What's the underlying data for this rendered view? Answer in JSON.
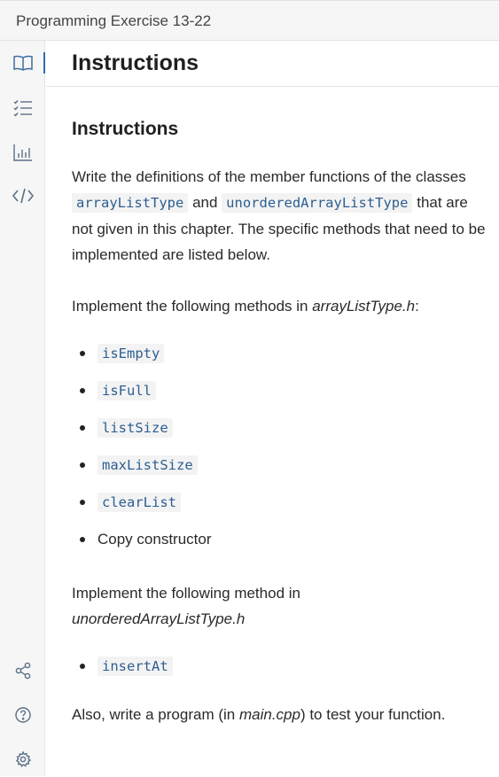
{
  "window": {
    "title": "Programming Exercise 13-22"
  },
  "sidebar": {
    "items": [
      {
        "name": "book-icon",
        "label": "Instructions"
      },
      {
        "name": "checklist-icon",
        "label": "Tasks"
      },
      {
        "name": "chart-icon",
        "label": "Results"
      },
      {
        "name": "code-icon",
        "label": "Code"
      },
      {
        "name": "share-icon",
        "label": "Share"
      },
      {
        "name": "help-icon",
        "label": "Help"
      },
      {
        "name": "gear-icon",
        "label": "Settings"
      }
    ],
    "accent_color": "#2b6cb0"
  },
  "header": {
    "title": "Instructions"
  },
  "content": {
    "heading": "Instructions",
    "intro": {
      "t1": "Write the definitions of the member functions of the classes",
      "code1": "arrayListType",
      "t2": "and",
      "code2": "unorderedArrayListType",
      "t3": "that are not given in this chapter. The specific methods that need to be implemented are listed below."
    },
    "section1": {
      "prefix": "Implement the following methods in",
      "file": "arrayListType.h",
      "suffix": ":"
    },
    "methods1": [
      {
        "label": "isEmpty",
        "is_code": true
      },
      {
        "label": "isFull",
        "is_code": true
      },
      {
        "label": "listSize",
        "is_code": true
      },
      {
        "label": "maxListSize",
        "is_code": true
      },
      {
        "label": "clearList",
        "is_code": true
      },
      {
        "label": "Copy constructor",
        "is_code": false
      }
    ],
    "section2": {
      "prefix": "Implement the following method in",
      "file": "unorderedArrayListType.h"
    },
    "methods2": [
      {
        "label": "insertAt",
        "is_code": true
      }
    ],
    "footer": {
      "prefix": "Also, write a program (in",
      "file": "main.cpp",
      "suffix": ") to test your function."
    }
  }
}
